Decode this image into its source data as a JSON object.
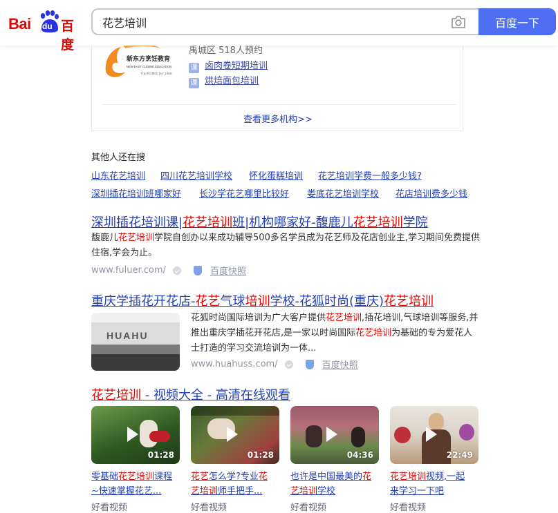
{
  "header": {
    "logo": {
      "bai": "Bai",
      "du": "du",
      "baidu": "百度"
    },
    "search_value": "花艺培训",
    "search_button": "百度一下"
  },
  "org_card": {
    "logo_name": "新东方烹饪教育",
    "logo_en": "NEW EAST CUISINE EDUCATION",
    "logo_sub": "专业烹饪教育 始于1988",
    "meta": "禹城区   518人预约",
    "course_icon": "课",
    "courses": [
      "卤肉卷短期培训",
      "烘焙面包培训"
    ],
    "more": "查看更多机构>>"
  },
  "related": {
    "title": "其他人还在搜",
    "row1": [
      "山东花艺培训",
      "四川花艺培训学校",
      "怀化蛋糕培训",
      "花艺培训学费一般多少钱?"
    ],
    "row2": [
      "深圳插花培训班哪家好",
      "长沙学花艺哪里比较好",
      "娄底花艺培训学校",
      "花店培训费多少钱"
    ]
  },
  "result1": {
    "t1": "深圳插花培训课|",
    "t2": "花艺培训",
    "t3": "班|机构哪家好-馥鹿儿",
    "t4": "花艺培训",
    "t5": "学院",
    "a1": "馥鹿儿",
    "a2": "花艺培训",
    "a3": "学院自创办以来成功辅导500多名学员成为花艺师及花店创业主,学习期间免费提供",
    "a4": "住宿,学会为止。",
    "url": "www.fuluer.com/",
    "cache": "百度快照"
  },
  "result2": {
    "t1": "重庆学插花开花店-",
    "t2": "花艺",
    "t3": "气球",
    "t4": "培训",
    "t5": "学校-花狐时尚(重庆)",
    "t6": "花艺培训",
    "thumb_text": "HUAHU",
    "a1": "花狐时尚国际培训为广大客户提供",
    "a2": "花艺培训",
    "a3": ",插花培训,气球培训等服务,并",
    "a4": "推出重庆学插花开花店,是一家以时尚国际",
    "a5": "花艺培训",
    "a6": "为基础的专为爱花人",
    "a7": "士打造的学习交流培训为一体...",
    "url": "www.huahuss.com/",
    "cache": "百度快照"
  },
  "videos": {
    "title_hl": "花艺培训",
    "title_rest": " - 视频大全 - 高清在线观看",
    "items": [
      {
        "duration": "01:28",
        "l1a": "零基础",
        "l1b": "花艺培训",
        "l1c": "课程",
        "l2": "~快速掌握花艺...",
        "source": "好看视频",
        "color": "#3d6b2a"
      },
      {
        "duration": "01:28",
        "l1a": "",
        "l1b": "花艺",
        "l1c": "怎么学?专业",
        "l1d": "花",
        "l2a": "艺培训",
        "l2b": "师手把手...",
        "source": "好看视频",
        "color": "#5a4a3a"
      },
      {
        "duration": "04:36",
        "l1a": "也许是中国最美的",
        "l1b": "花",
        "l2a": "艺培训",
        "l2b": "学校",
        "source": "好看视频",
        "color": "#7a4a5a"
      },
      {
        "duration": "22:49",
        "l1a": "",
        "l1b": "花艺培训",
        "l1c": "视频,一起",
        "l2": "来学习一下吧",
        "source": "好看视频",
        "color": "#8a6a4a"
      }
    ]
  }
}
